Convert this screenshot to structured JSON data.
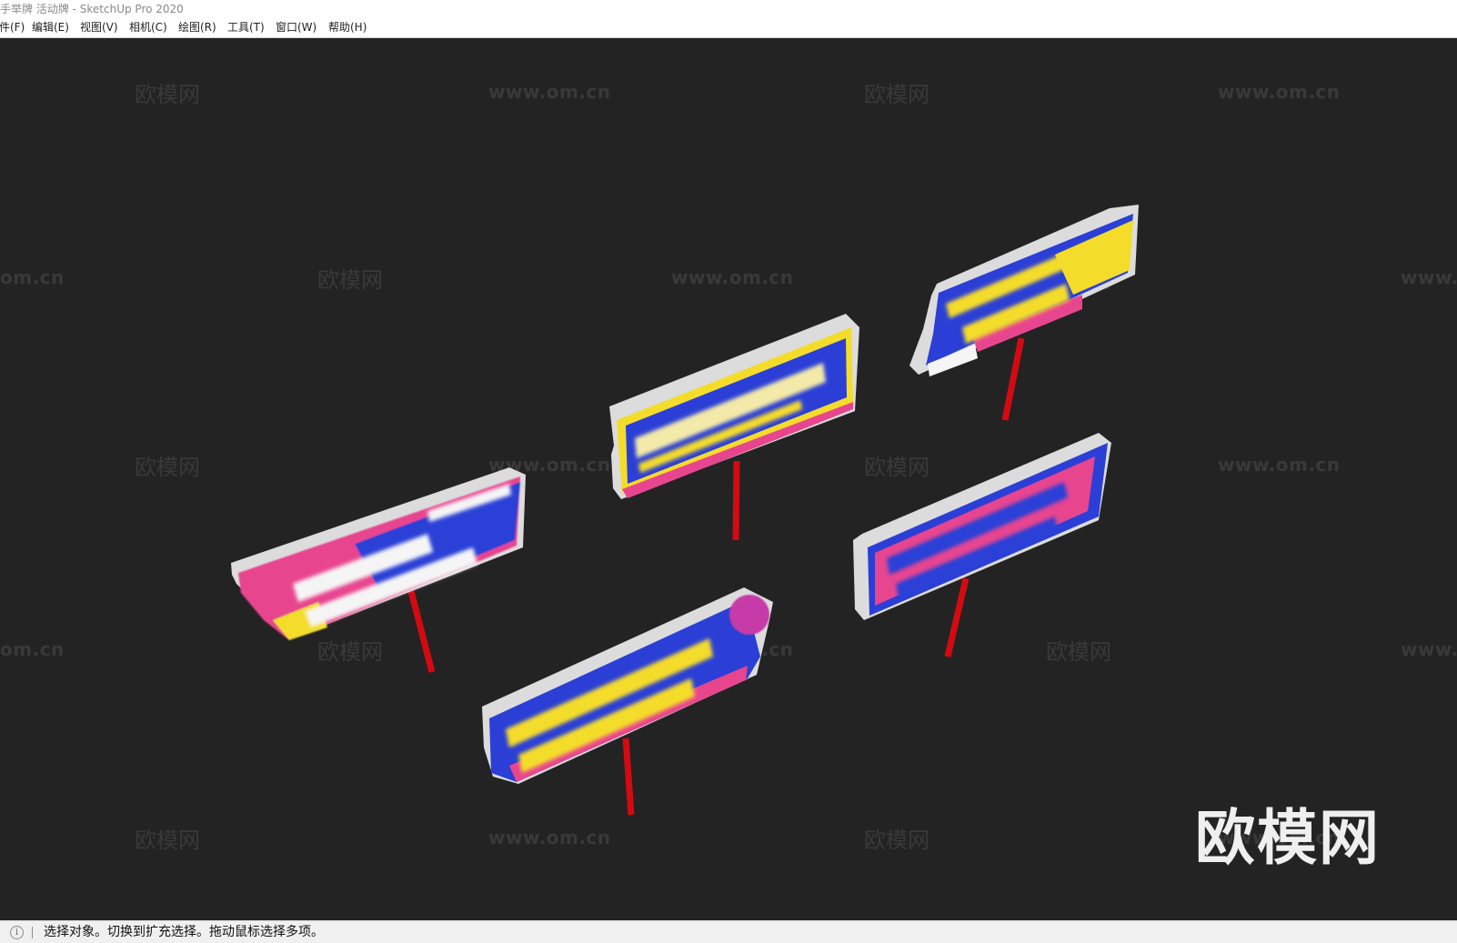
{
  "window": {
    "title": "手举牌 活动牌 - SketchUp Pro 2020"
  },
  "menu": [
    {
      "label": "件(F)"
    },
    {
      "label": "编辑(E)"
    },
    {
      "label": "视图(V)"
    },
    {
      "label": "相机(C)"
    },
    {
      "label": "绘图(R)"
    },
    {
      "label": "工具(T)"
    },
    {
      "label": "窗口(W)"
    },
    {
      "label": "帮助(H)"
    }
  ],
  "watermarks": {
    "brand": "欧模网",
    "url": "www.om.cn",
    "url_partial": "om.cn",
    "url_partial_right": "www."
  },
  "watermark_large": "欧模网",
  "status": {
    "icon": "info-icon",
    "text": "选择对象。切换到扩充选择。拖动鼠标选择多项。"
  },
  "colors": {
    "viewport_bg": "#232323",
    "sign_blue": "#2b3fd6",
    "sign_pink": "#e8458f",
    "sign_yellow": "#f2d21f",
    "sign_edge": "#d9d9d9",
    "pole_red": "#d40a12"
  }
}
